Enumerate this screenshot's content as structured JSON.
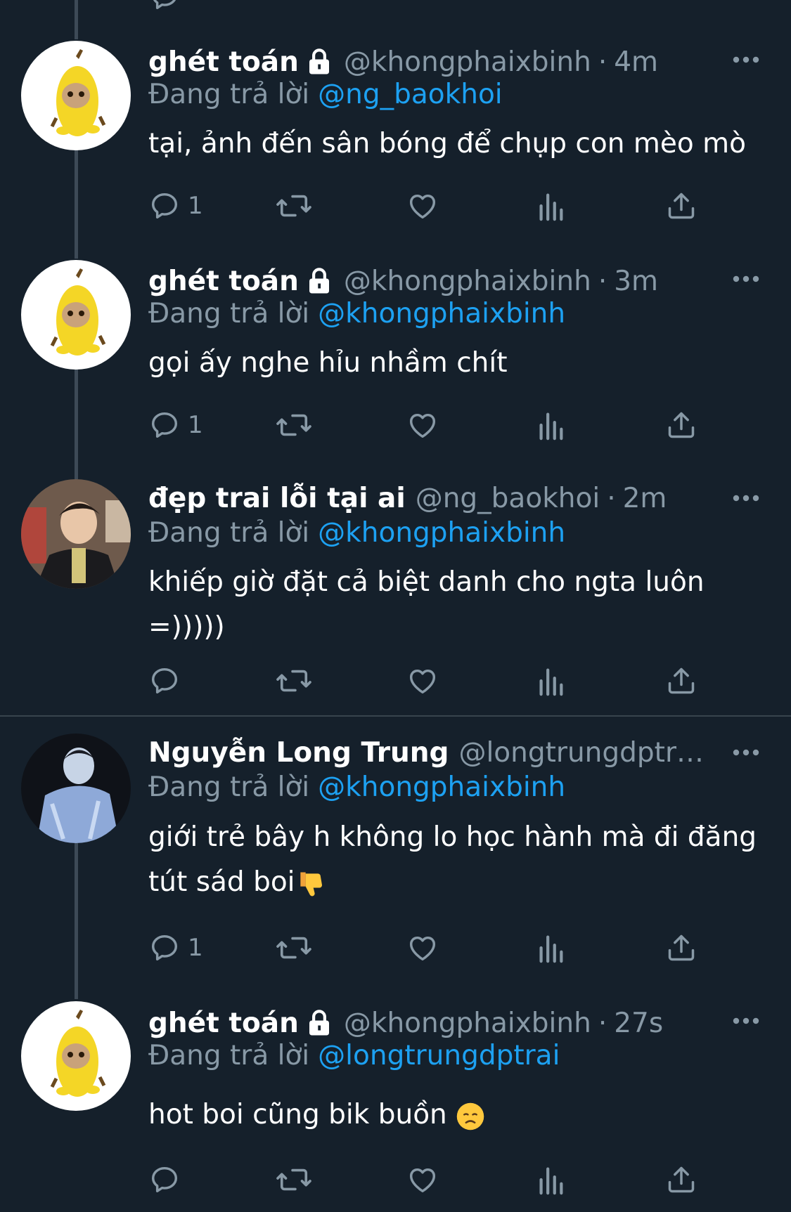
{
  "tweets": [
    {
      "display_name": "ghét toán",
      "locked": true,
      "handle": "@khongphaixbinh",
      "sep": "·",
      "time": "4m",
      "reply_prefix": "Đang trả lời",
      "reply_to": "@ng_baokhoi",
      "text": "tại, ảnh đến sân bóng để chụp con mèo mò",
      "reply_count": "1",
      "avatar": "banana-cat"
    },
    {
      "display_name": "ghét toán",
      "locked": true,
      "handle": "@khongphaixbinh",
      "sep": "·",
      "time": "3m",
      "reply_prefix": "Đang trả lời",
      "reply_to": "@khongphaixbinh",
      "text": "gọi ấy nghe hỉu nhầm chít",
      "reply_count": "1",
      "avatar": "banana-cat"
    },
    {
      "display_name": "đẹp trai lỗi tại ai",
      "locked": false,
      "handle": "@ng_baokhoi",
      "sep": "·",
      "time": "2m",
      "reply_prefix": "Đang trả lời",
      "reply_to": "@khongphaixbinh",
      "text": "khiếp giờ đặt cả biệt danh cho ngta luôn =)))))",
      "reply_count": "",
      "avatar": "portrait-boy"
    },
    {
      "display_name": "Nguyễn Long Trung",
      "locked": false,
      "handle": "@longtrungdptrai ...",
      "sep": "",
      "time": "",
      "reply_prefix": "Đang trả lời",
      "reply_to": "@khongphaixbinh",
      "text": "giới trẻ bây h không lo học hành mà đi đăng tút sád boi",
      "emoji": "thumbs-down",
      "reply_count": "1",
      "avatar": "portrait-denim"
    },
    {
      "display_name": "ghét toán",
      "locked": true,
      "handle": "@khongphaixbinh",
      "sep": "·",
      "time": "27s",
      "reply_prefix": "Đang trả lời",
      "reply_to": "@longtrungdptrai",
      "text": "hot boi cũng bik buồn ",
      "emoji": "disappointed-face",
      "reply_count": "",
      "avatar": "banana-cat"
    }
  ],
  "icons": {
    "reply": "reply-icon",
    "retweet": "retweet-icon",
    "like": "heart-icon",
    "analytics": "analytics-icon",
    "share": "share-icon",
    "more": "more-icon",
    "lock": "lock-icon"
  },
  "colors": {
    "background": "#15202b",
    "muted": "#8899a6",
    "link": "#1da1f2",
    "thread_line": "#3d4a57"
  }
}
